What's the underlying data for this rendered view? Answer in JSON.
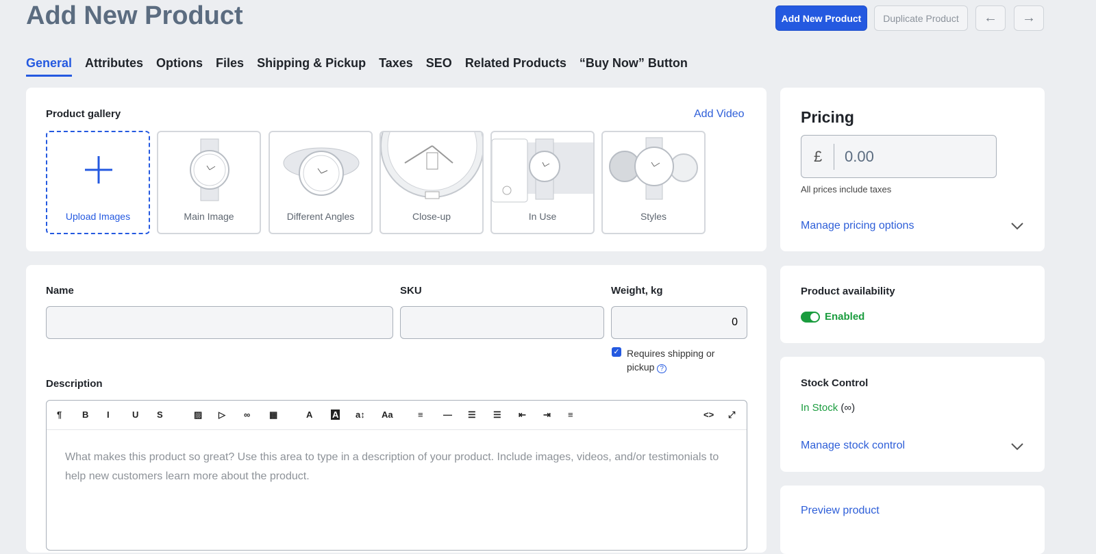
{
  "header": {
    "title": "Add New Product",
    "add_button": "Add New Product",
    "duplicate_button": "Duplicate Product",
    "prev_icon": "←",
    "next_icon": "→"
  },
  "tabs": [
    {
      "label": "General"
    },
    {
      "label": "Attributes"
    },
    {
      "label": "Options"
    },
    {
      "label": "Files"
    },
    {
      "label": "Shipping & Pickup"
    },
    {
      "label": "Taxes"
    },
    {
      "label": "SEO"
    },
    {
      "label": "Related Products"
    },
    {
      "label": "“Buy Now” Button"
    }
  ],
  "gallery": {
    "title": "Product gallery",
    "add_video": "Add Video",
    "upload": "Upload Images",
    "tiles": [
      {
        "label": "Main Image"
      },
      {
        "label": "Different Angles"
      },
      {
        "label": "Close-up"
      },
      {
        "label": "In Use"
      },
      {
        "label": "Styles"
      }
    ]
  },
  "form": {
    "name_label": "Name",
    "name_value": "",
    "sku_label": "SKU",
    "sku_value": "",
    "weight_label": "Weight, kg",
    "weight_value": "0",
    "requires_shipping": "Requires shipping or pickup",
    "requires_shipping_checked": true,
    "description_label": "Description",
    "description_placeholder": "What makes this product so great? Use this area to type in a description of your product. Include images, videos, and/or testimonials to help new customers learn more about the product."
  },
  "toolbar": [
    "¶",
    "B",
    "I",
    "U",
    "S",
    "image",
    "video",
    "link",
    "table",
    "A",
    "A",
    "a↕",
    "Aa",
    "align",
    "hr",
    "ul",
    "ol",
    "outdent",
    "indent",
    "more",
    "<>",
    "⤢"
  ],
  "pricing": {
    "title": "Pricing",
    "currency": "£",
    "price": "0.00",
    "note": "All prices include taxes",
    "manage": "Manage pricing options"
  },
  "availability": {
    "title": "Product availability",
    "status": "Enabled",
    "enabled": true
  },
  "stock": {
    "title": "Stock Control",
    "status": "In Stock",
    "qty": "(∞)",
    "manage": "Manage stock control"
  },
  "preview": {
    "label": "Preview product"
  },
  "colors": {
    "accent": "#2459e0",
    "success": "#1a9c3e"
  }
}
